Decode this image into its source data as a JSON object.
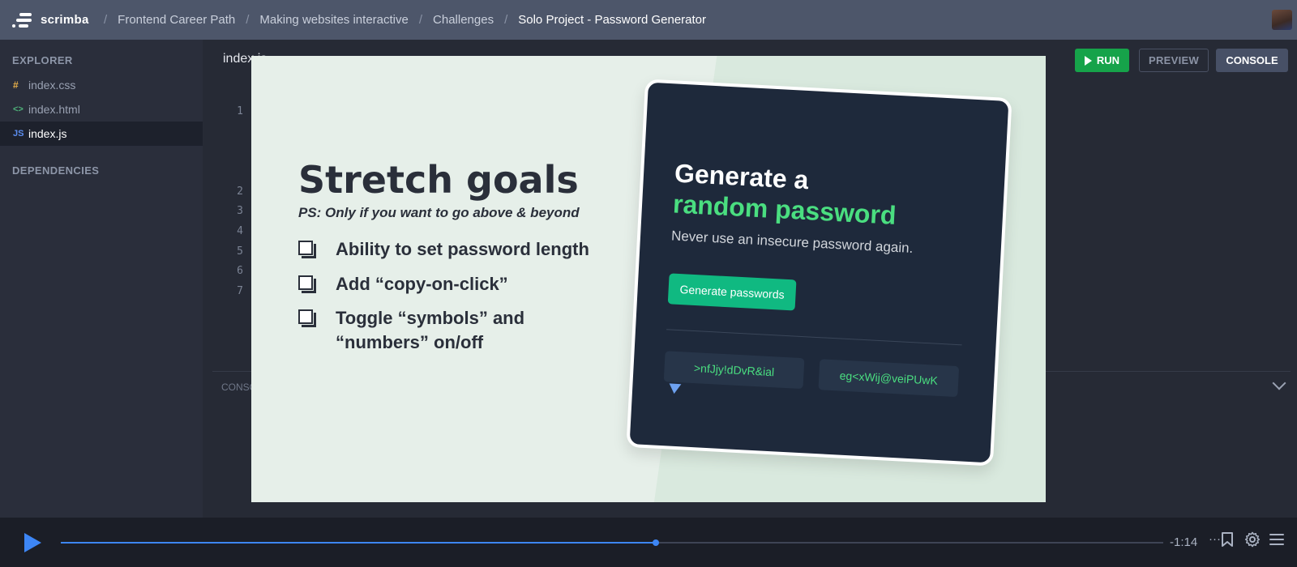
{
  "topbar": {
    "brand": "scrimba",
    "breadcrumbs": [
      "Frontend Career Path",
      "Making websites interactive",
      "Challenges"
    ],
    "current": "Solo Project - Password Generator"
  },
  "sidebar": {
    "explorer_label": "EXPLORER",
    "files": [
      {
        "icon": "#",
        "name": "index.css",
        "color": "#e8b04a"
      },
      {
        "icon": "<>",
        "name": "index.html",
        "color": "#4fb37a"
      },
      {
        "icon": "JS",
        "name": "index.js",
        "color": "#5b8def"
      }
    ],
    "dependencies_label": "DEPENDENCIES"
  },
  "editor": {
    "tab": "index.js",
    "line_numbers": [
      "1",
      "2",
      "3",
      "4",
      "5",
      "6",
      "7"
    ],
    "run_label": "RUN",
    "preview_label": "PREVIEW",
    "console_label": "CONSOLE",
    "console_panel_label": "CONSOLE"
  },
  "slide": {
    "title": "Stretch goals",
    "subtitle": "PS: Only if you want to go above & beyond",
    "goals": [
      "Ability to set password length",
      "Add “copy-on-click”",
      "Toggle “symbols” and “numbers” on/off"
    ],
    "card": {
      "heading_line1": "Generate a",
      "heading_line2": "random password",
      "description": "Never use an insecure password again.",
      "button": "Generate passwords",
      "passwords": [
        ">nfJjy!dDvR&ial",
        "eg<xWij@veiPUwK"
      ]
    }
  },
  "player": {
    "time_remaining": "-1:14",
    "progress": 0.54,
    "accent": "#3d86f5"
  }
}
